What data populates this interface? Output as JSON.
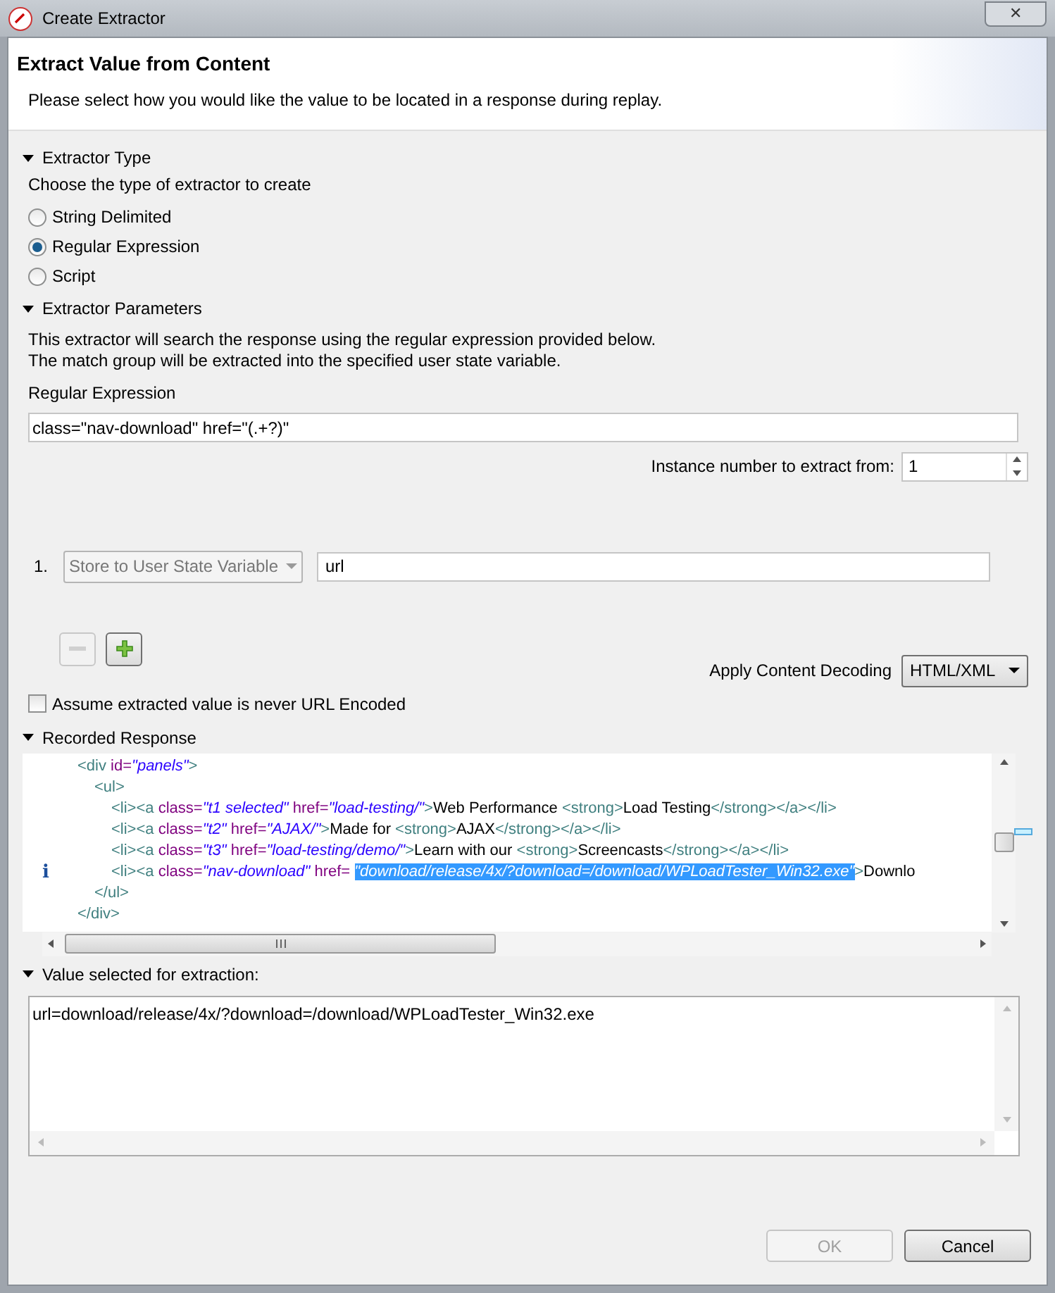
{
  "window": {
    "title": "Create Extractor",
    "close": "✕"
  },
  "header": {
    "title": "Extract Value from Content",
    "description": "Please select how you would like the value to be located in a response during replay."
  },
  "extractor_type": {
    "heading": "Extractor Type",
    "expanded": true,
    "hint": "Choose the type of extractor to create",
    "options": [
      {
        "label": "String Delimited",
        "selected": false
      },
      {
        "label": "Regular Expression",
        "selected": true
      },
      {
        "label": "Script",
        "selected": false
      }
    ]
  },
  "extractor_parameters": {
    "heading": "Extractor Parameters",
    "expanded": true,
    "description": [
      "This extractor will search the response using the regular expression provided below.",
      "The match group will be extracted into the specified user state variable."
    ],
    "regex_label": "Regular Expression",
    "regex_value": "class=\"nav-download\" href=\"(.+?)\"",
    "instance_label": "Instance number to extract from:",
    "instance_value": "1",
    "groups": [
      {
        "number": "1.",
        "action": "Store to User State Variable",
        "action_disabled": true,
        "variable": "url"
      }
    ],
    "remove_disabled": true,
    "add_disabled": false,
    "decoding_label": "Apply Content Decoding",
    "decoding_value": "HTML/XML",
    "never_encoded": {
      "label": "Assume extracted value is never URL Encoded",
      "checked": false
    }
  },
  "recorded_response": {
    "heading": "Recorded Response",
    "expanded": true,
    "info_mark": "i",
    "lines": [
      {
        "tokens": [
          {
            "kind": "tag",
            "text": "<div"
          },
          {
            "kind": "attr",
            "text": " id="
          },
          {
            "kind": "value",
            "text": "\"panels\""
          },
          {
            "kind": "tag",
            "text": ">"
          }
        ],
        "children": [
          {
            "tokens": [
              {
                "kind": "tag",
                "text": "<ul>"
              }
            ],
            "children": [
              {
                "tokens": [
                  {
                    "kind": "tag",
                    "text": "<li><a"
                  },
                  {
                    "kind": "attr",
                    "text": " class="
                  },
                  {
                    "kind": "value",
                    "text": "\"t1 selected\""
                  },
                  {
                    "kind": "attr",
                    "text": " href="
                  },
                  {
                    "kind": "value",
                    "text": "\"load-testing/\""
                  },
                  {
                    "kind": "tag",
                    "text": ">"
                  },
                  {
                    "kind": "text",
                    "text": "Web Performance "
                  },
                  {
                    "kind": "tag",
                    "text": "<strong>"
                  },
                  {
                    "kind": "text",
                    "text": "Load Testing"
                  },
                  {
                    "kind": "tag",
                    "text": "</strong></a></li>"
                  }
                ]
              },
              {
                "tokens": [
                  {
                    "kind": "tag",
                    "text": "<li><a"
                  },
                  {
                    "kind": "attr",
                    "text": " class="
                  },
                  {
                    "kind": "value",
                    "text": "\"t2\""
                  },
                  {
                    "kind": "attr",
                    "text": " href="
                  },
                  {
                    "kind": "value",
                    "text": "\"AJAX/\""
                  },
                  {
                    "kind": "tag",
                    "text": ">"
                  },
                  {
                    "kind": "text",
                    "text": "Made for "
                  },
                  {
                    "kind": "tag",
                    "text": "<strong>"
                  },
                  {
                    "kind": "text",
                    "text": "AJAX"
                  },
                  {
                    "kind": "tag",
                    "text": "</strong></a></li>"
                  }
                ]
              },
              {
                "tokens": [
                  {
                    "kind": "tag",
                    "text": "<li><a"
                  },
                  {
                    "kind": "attr",
                    "text": " class="
                  },
                  {
                    "kind": "value",
                    "text": "\"t3\""
                  },
                  {
                    "kind": "attr",
                    "text": " href="
                  },
                  {
                    "kind": "value",
                    "text": "\"load-testing/demo/\""
                  },
                  {
                    "kind": "tag",
                    "text": ">"
                  },
                  {
                    "kind": "text",
                    "text": "Learn with our "
                  },
                  {
                    "kind": "tag",
                    "text": "<strong>"
                  },
                  {
                    "kind": "text",
                    "text": "Screencasts"
                  },
                  {
                    "kind": "tag",
                    "text": "</strong></a></li>"
                  }
                ]
              },
              {
                "tokens": [
                  {
                    "kind": "tag",
                    "text": "<li><a"
                  },
                  {
                    "kind": "attr",
                    "text": " class="
                  },
                  {
                    "kind": "value",
                    "text": "\"nav-download\""
                  },
                  {
                    "kind": "attr",
                    "text": " href= "
                  },
                  {
                    "kind": "selected",
                    "text": "\"download/release/4x/?download=/download/WPLoadTester_Win32.exe\""
                  },
                  {
                    "kind": "tag",
                    "text": ">"
                  },
                  {
                    "kind": "text",
                    "text": "Downlo"
                  }
                ],
                "marked": true
              }
            ]
          },
          {
            "tokens": [
              {
                "kind": "tag",
                "text": "</ul>"
              }
            ]
          }
        ]
      },
      {
        "tokens": [
          {
            "kind": "tag",
            "text": "</div>"
          }
        ]
      }
    ]
  },
  "value_selected": {
    "heading": "Value selected for extraction:",
    "expanded": true,
    "value": "url=download/release/4x/?download=/download/WPLoadTester_Win32.exe"
  },
  "buttons": [
    {
      "label": "OK",
      "disabled": true
    },
    {
      "label": "Cancel",
      "disabled": false
    }
  ]
}
